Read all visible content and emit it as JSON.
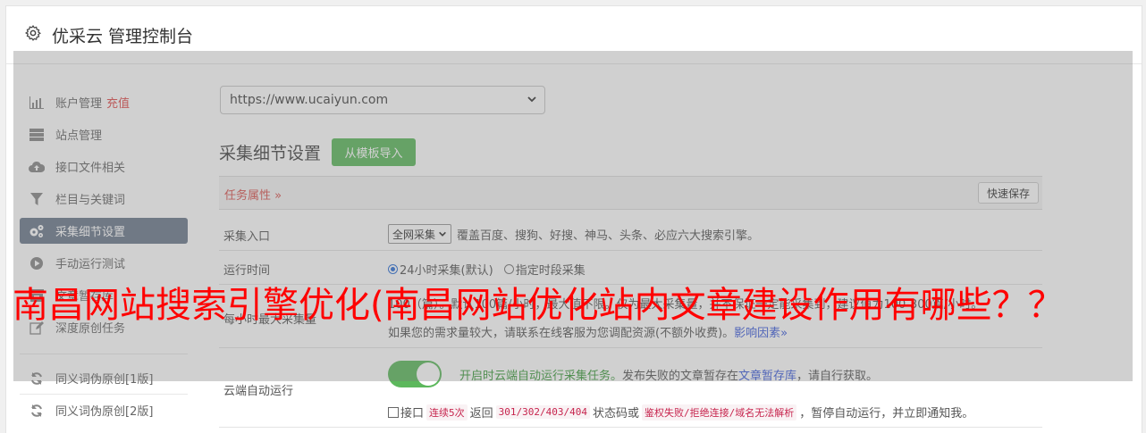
{
  "header": {
    "title": "优采云 管理控制台",
    "icon": "gear-icon"
  },
  "sidebar": {
    "items": [
      {
        "label": "账户管理",
        "extra": "充值",
        "icon": "bar-chart-icon"
      },
      {
        "label": "站点管理",
        "icon": "server-icon"
      },
      {
        "label": "接口文件相关",
        "icon": "cloud-upload-icon"
      },
      {
        "label": "栏目与关键词",
        "icon": "filter-icon"
      },
      {
        "label": "采集细节设置",
        "icon": "cogs-icon",
        "active": true
      },
      {
        "label": "手动运行测试",
        "icon": "play-circle-icon"
      },
      {
        "label": "文章暂存库",
        "icon": "archive-icon"
      },
      {
        "label": "深度原创任务",
        "icon": "edit-icon"
      },
      {
        "label": "同义词伪原创[1版]",
        "icon": "refresh-icon"
      },
      {
        "label": "同义词伪原创[2版]",
        "icon": "refresh-icon"
      }
    ]
  },
  "main": {
    "site_select": "https://www.ucaiyun.com",
    "section_title": "采集细节设置",
    "import_button": "从模板导入",
    "task_attr": "任务属性",
    "quick_save": "快速保存",
    "rows": {
      "entry": {
        "label": "采集入口",
        "select": "全网采集",
        "desc": "覆盖百度、搜狗、好搜、神马、头条、必应六大搜索引擎。"
      },
      "runtime": {
        "label": "运行时间",
        "opt1": "24小时采集(默认)",
        "opt2": "指定时段采集"
      },
      "max": {
        "label": "每小时最大采集量",
        "line1": "100（篇）。默认100篇/小时，最大值不限。仅为最大采集量，并不保证一定能采集到，建议值为100-300篇/小时。",
        "line2": "如果您的需求量较大，请联系在线客服为您调配资源(不额外收费)。",
        "link": "影响因素"
      },
      "cloud": {
        "label": "云端自动运行",
        "toggle_text": "开启时云端自动运行采集任务。",
        "text2": "发布失败的文章暂存在",
        "link": "文章暂存库",
        "text3": "，请自行获取。",
        "chk_prefix": "接口",
        "code1": "连续5次",
        "mid1": "返回",
        "code2": "301/302/403/404",
        "mid2": "状态码或",
        "code3": "鉴权失败/拒绝连接/域名无法解析",
        "tail": "，暂停自动运行，并立即通知我。"
      }
    }
  },
  "watermark": "南昌网站搜索引擎优化(南昌网站优化站内文章建设作用有哪些？？",
  "colors": {
    "accent_green": "#5cb85c",
    "active_nav": "#6c7a8d",
    "watermark": "#ff0000",
    "danger": "#d9534f"
  }
}
